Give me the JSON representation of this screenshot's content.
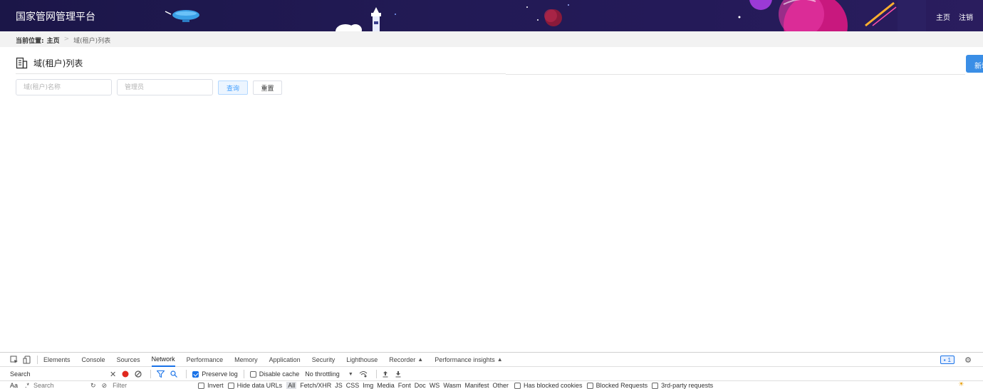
{
  "header": {
    "title": "国家管网管理平台",
    "nav": [
      "主页",
      "注销"
    ]
  },
  "breadcrumb": {
    "prefix": "当前位置:",
    "home": "主页",
    "separator": ">",
    "current": "域(租户)列表"
  },
  "page": {
    "title": "域(租户)列表",
    "title_icon": "building-icon",
    "new_button_label": "新增"
  },
  "search": {
    "name_placeholder": "域(租户)名称",
    "name_value": "",
    "admin_placeholder": "管理员",
    "admin_value": "",
    "query_label": "查询",
    "reset_label": "重置"
  },
  "devtools": {
    "tabs": [
      "Elements",
      "Console",
      "Sources",
      "Network",
      "Performance",
      "Memory",
      "Application",
      "Security",
      "Lighthouse",
      "Recorder",
      "Performance insights"
    ],
    "active_tab": "Network",
    "issues_count": "1",
    "search_tab": "Search",
    "preserve_log": "Preserve log",
    "disable_cache": "Disable cache",
    "throttling": "No throttling",
    "search_option": "Aa",
    "search_option2": ".*",
    "search_placeholder": "Search",
    "filter_placeholder": "Filter",
    "invert": "Invert",
    "hide_data_urls": "Hide data URLs",
    "filter_types": [
      "All",
      "Fetch/XHR",
      "JS",
      "CSS",
      "Img",
      "Media",
      "Font",
      "Doc",
      "WS",
      "Wasm",
      "Manifest",
      "Other"
    ],
    "has_blocked_cookies": "Has blocked cookies",
    "blocked_requests": "Blocked Requests",
    "third_party": "3rd-party requests"
  },
  "colors": {
    "header_bg": "#1b1648",
    "primary": "#409eff",
    "new_button": "#3a8ee6",
    "devtools_accent": "#1a73e8"
  }
}
